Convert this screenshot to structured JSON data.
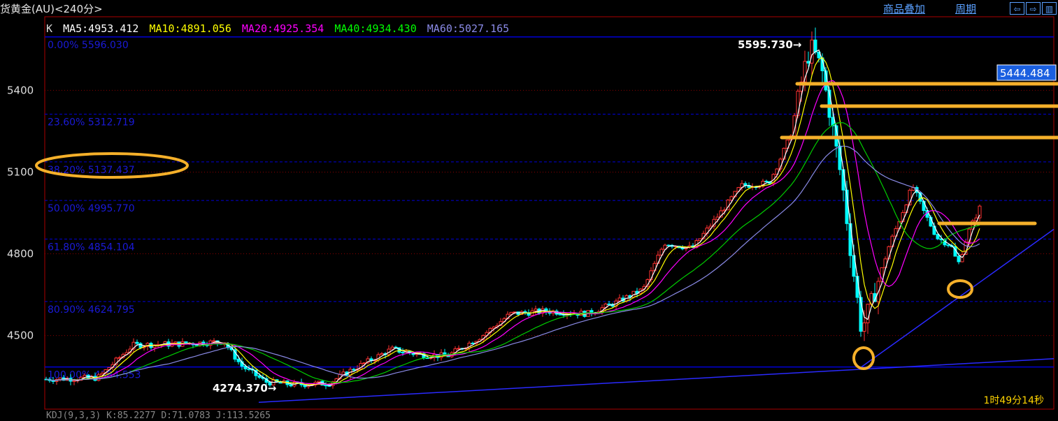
{
  "header": {
    "title": "货黄金(AU)<240分>",
    "links": [
      "商品叠加",
      "周期"
    ]
  },
  "indicators": {
    "prefix": "K",
    "ma": [
      {
        "label": "MA5:4953.412",
        "color": "#ffffff"
      },
      {
        "label": "MA10:4891.056",
        "color": "#ffff00"
      },
      {
        "label": "MA20:4925.354",
        "color": "#ff00ff"
      },
      {
        "label": "MA40:4934.430",
        "color": "#00ff00"
      },
      {
        "label": "MA60:5027.165",
        "color": "#8a8ae6"
      }
    ]
  },
  "price_labels": {
    "current": "5444.484",
    "high": "5595.730→",
    "low": "4274.370→"
  },
  "timer": "1时49分14秒",
  "bottom_text": "KDJ(9,3,3) K:85.2277 D:71.0783 J:113.5265",
  "chart_data": {
    "type": "candlestick",
    "title": "货黄金(AU)<240分>",
    "y_ticks": [
      4500,
      4800,
      5100,
      5400
    ],
    "ylim": [
      4230,
      5670
    ],
    "fibonacci": [
      {
        "label": "0.00% 5596.030",
        "value": 5596.03
      },
      {
        "label": "23.60% 5312.719",
        "value": 5312.719
      },
      {
        "label": "38.20% 5137.437",
        "value": 5137.437
      },
      {
        "label": "50.00% 4995.770",
        "value": 4995.77
      },
      {
        "label": "61.80% 4854.104",
        "value": 4854.104
      },
      {
        "label": "80.90% 4624.795",
        "value": 4624.795
      },
      {
        "label": "100.00% 4384.553",
        "value": 4384.553
      }
    ],
    "red_gridlines": [
      4500,
      4800,
      5100,
      5400
    ],
    "colors": {
      "up": "#ff3232",
      "down": "#00ffff",
      "fib": "#0000d8",
      "annotation": "#f5b02a"
    }
  }
}
